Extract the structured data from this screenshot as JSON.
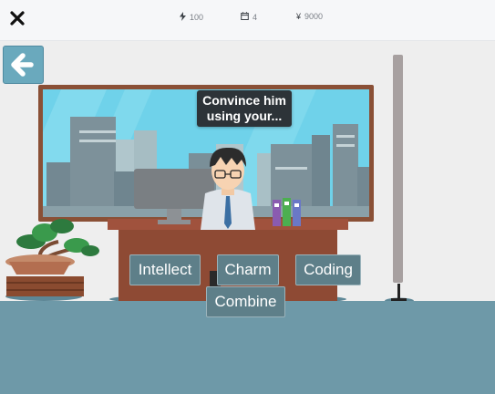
{
  "topbar": {
    "energy": {
      "icon": "lightning-icon",
      "value": "100"
    },
    "days": {
      "icon": "calendar-icon",
      "value": "4"
    },
    "money": {
      "icon": "yen-icon",
      "symbol": "¥",
      "value": "9000"
    }
  },
  "scene": {
    "tooltip_text": "Convince him using your...",
    "choices": [
      "Intellect",
      "Charm",
      "Coding",
      "Combine"
    ]
  },
  "colors": {
    "topbar_bg": "#f6f7f9",
    "wall": "#eeeeee",
    "floor": "#6e99a8",
    "window_frame": "#8a5036",
    "window_glass": "#6fd2ea",
    "desk_top": "#a0523d",
    "button_bg": "#5e7f89",
    "back_button_bg": "#6aa9bd",
    "tooltip_bg": "#2d3338"
  }
}
